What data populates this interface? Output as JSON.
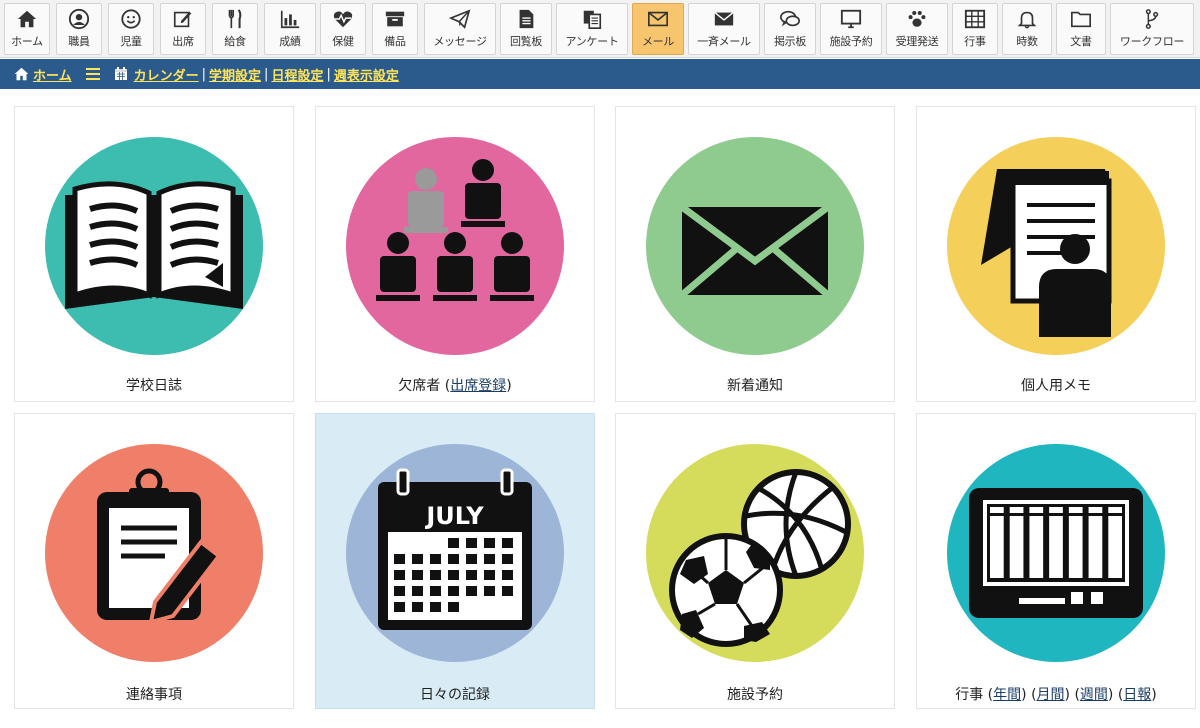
{
  "toolbar": {
    "items": [
      {
        "label": "ホーム",
        "icon": "home-icon"
      },
      {
        "label": "職員",
        "icon": "user-circle-icon"
      },
      {
        "label": "児童",
        "icon": "smile-icon"
      },
      {
        "label": "出席",
        "icon": "edit-icon"
      },
      {
        "label": "給食",
        "icon": "cutlery-icon"
      },
      {
        "label": "成績",
        "icon": "bar-chart-icon"
      },
      {
        "label": "保健",
        "icon": "heartbeat-icon"
      },
      {
        "label": "備品",
        "icon": "archive-icon"
      },
      {
        "label": "メッセージ",
        "icon": "paper-plane-icon"
      },
      {
        "label": "回覧板",
        "icon": "document-icon"
      },
      {
        "label": "アンケート",
        "icon": "copy-icon"
      },
      {
        "label": "メール",
        "icon": "envelope-outline-icon",
        "active": true
      },
      {
        "label": "一斉メール",
        "icon": "envelope-icon"
      },
      {
        "label": "掲示板",
        "icon": "comments-icon"
      },
      {
        "label": "施設予約",
        "icon": "monitor-icon"
      },
      {
        "label": "受理発送",
        "icon": "paw-icon"
      },
      {
        "label": "行事",
        "icon": "table-icon"
      },
      {
        "label": "時数",
        "icon": "bell-icon"
      },
      {
        "label": "文書",
        "icon": "folder-icon"
      },
      {
        "label": "ワークフロー",
        "icon": "workflow-icon"
      }
    ]
  },
  "breadcrumb": {
    "home": "ホーム",
    "calendar": "カレンダー",
    "sep": "|",
    "links": [
      "学期設定",
      "日程設定",
      "週表示設定"
    ]
  },
  "cards": {
    "school_diary": {
      "label": "学校日誌",
      "icon": "open-book-icon",
      "color": "#3dbcb0"
    },
    "absentees": {
      "label": "欠席者",
      "paren_open": "(",
      "link": "出席登録",
      "paren_close": ")",
      "icon": "class-people-icon",
      "color": "#e2679f"
    },
    "news": {
      "label": "新着通知",
      "icon": "envelope-icon",
      "color": "#8fcb8f"
    },
    "memo": {
      "label": "個人用メモ",
      "icon": "notepad-person-icon",
      "color": "#f4d05a"
    },
    "contact": {
      "label": "連絡事項",
      "icon": "clipboard-pencil-icon",
      "color": "#ef7f69"
    },
    "daily_record": {
      "label": "日々の記録",
      "icon": "calendar-icon",
      "calendar_text": "JULY",
      "color": "#9db6d8"
    },
    "facility": {
      "label": "施設予約",
      "icon": "sports-balls-icon",
      "color": "#d5dc5c"
    },
    "events": {
      "label": "行事",
      "links": [
        "年間",
        "月間",
        "週間",
        "日報"
      ],
      "icon": "schedule-board-icon",
      "color": "#1fb6c0"
    }
  }
}
